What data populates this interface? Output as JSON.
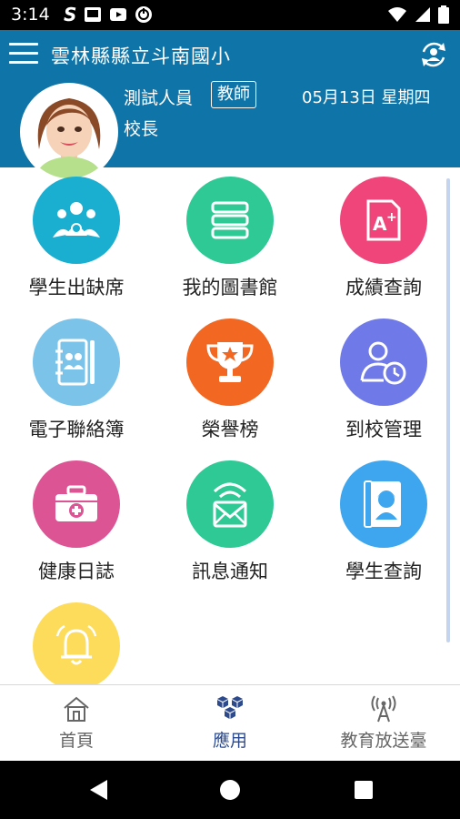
{
  "status_bar": {
    "time": "3:14",
    "left_icons": [
      "s-app-icon",
      "photo-icon",
      "youtube-icon",
      "sync-icon"
    ],
    "right_icons": [
      "wifi-icon",
      "signal-icon",
      "battery-icon"
    ]
  },
  "header": {
    "title": "雲林縣縣立斗南國小",
    "user_name": "測試人員",
    "role": "教師",
    "date": "05月13日 星期四",
    "user_title": "校長"
  },
  "apps": [
    {
      "label": "學生出缺席",
      "color": "#1aaed0",
      "icon": "students-group-icon"
    },
    {
      "label": "我的圖書館",
      "color": "#2ec995",
      "icon": "books-icon"
    },
    {
      "label": "成績查詢",
      "color": "#f0457a",
      "icon": "grade-a-plus-icon"
    },
    {
      "label": "電子聯絡簿",
      "color": "#7cc3ea",
      "icon": "contact-book-icon"
    },
    {
      "label": "榮譽榜",
      "color": "#f26722",
      "icon": "trophy-icon"
    },
    {
      "label": "到校管理",
      "color": "#6f79e8",
      "icon": "user-clock-icon"
    },
    {
      "label": "健康日誌",
      "color": "#dd5494",
      "icon": "medical-kit-icon"
    },
    {
      "label": "訊息通知",
      "color": "#2ec995",
      "icon": "message-signal-icon"
    },
    {
      "label": "學生查詢",
      "color": "#3ea6ef",
      "icon": "student-profile-icon"
    },
    {
      "label": "",
      "color": "#fddc5c",
      "icon": "bell-icon"
    }
  ],
  "bottom_nav": {
    "home": "首頁",
    "apps": "應用",
    "broadcast": "教育放送臺",
    "active": "應用",
    "active_color": "#2d4a8c"
  },
  "colors": {
    "header_bg": "#0f74a7",
    "scrollbar": "#c5d4ee"
  }
}
